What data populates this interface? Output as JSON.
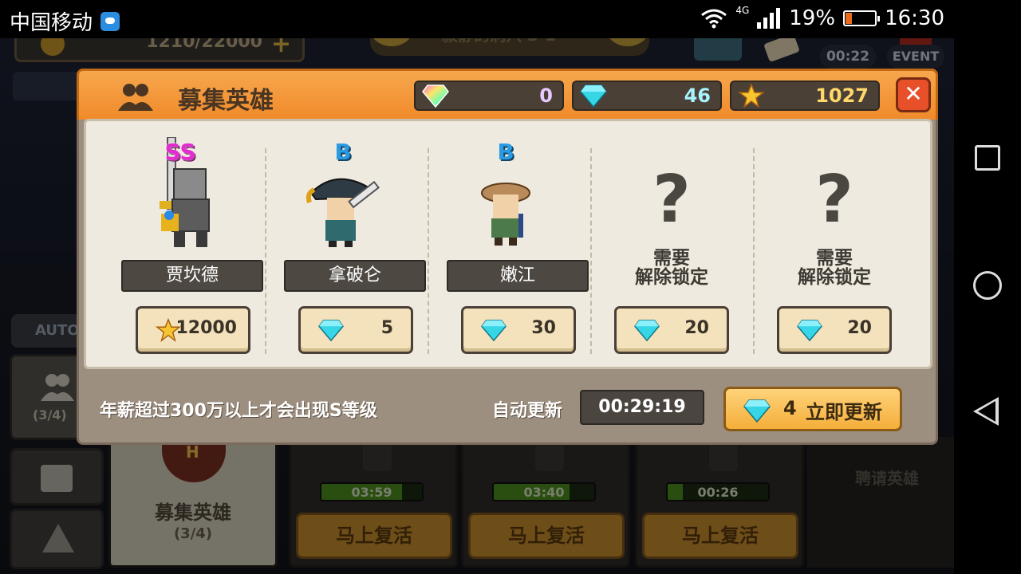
{
  "status_bar": {
    "carrier": "中国移动",
    "network": "4G",
    "battery": "19%",
    "time": "16:30"
  },
  "background": {
    "gold": "1210/22000",
    "stage": "寂静的洞穴 3-1",
    "event_timer": "00:22",
    "event_label": "EVENT",
    "auto_label": "AUTO",
    "heroes_count": "(3/4)",
    "recruit_title": "募集英雄",
    "recruit_count": "(3/4)",
    "slots": [
      {
        "timer": "03:59",
        "progress": 0.8,
        "button": "马上复活"
      },
      {
        "timer": "03:40",
        "progress": 0.75,
        "button": "马上复活"
      },
      {
        "timer": "00:26",
        "progress": 0.15,
        "button": "马上复活"
      }
    ],
    "hire_label": "聘请英雄"
  },
  "dialog": {
    "title": "募集英雄",
    "currencies": {
      "rainbow_gems": "0",
      "gems": "46",
      "stars": "1027"
    },
    "close_icon": "close-icon",
    "heroes": [
      {
        "grade": "SS",
        "name": "贾坎德",
        "cost_type": "star",
        "cost": "12000",
        "locked": false
      },
      {
        "grade": "B",
        "name": "拿破仑",
        "cost_type": "gem",
        "cost": "5",
        "locked": false
      },
      {
        "grade": "B",
        "name": "嫩江",
        "cost_type": "gem",
        "cost": "30",
        "locked": false
      },
      {
        "grade": "",
        "name": "",
        "locked_line1": "需要",
        "locked_line2": "解除锁定",
        "cost_type": "gem",
        "cost": "20",
        "locked": true
      },
      {
        "grade": "",
        "name": "",
        "locked_line1": "需要",
        "locked_line2": "解除锁定",
        "cost_type": "gem",
        "cost": "20",
        "locked": true
      }
    ],
    "footer_note": "年薪超过300万以上才会出现S等级",
    "auto_refresh_label": "自动更新",
    "auto_refresh_timer": "00:29:19",
    "refresh_cost": "4",
    "refresh_label": "立即更新"
  },
  "colors": {
    "header_orange": "#f08a2a",
    "gem_cyan": "#37d6e6",
    "grade_ss": "#e52bd0",
    "grade_b": "#2c9ae0",
    "close_red": "#e8502a"
  }
}
